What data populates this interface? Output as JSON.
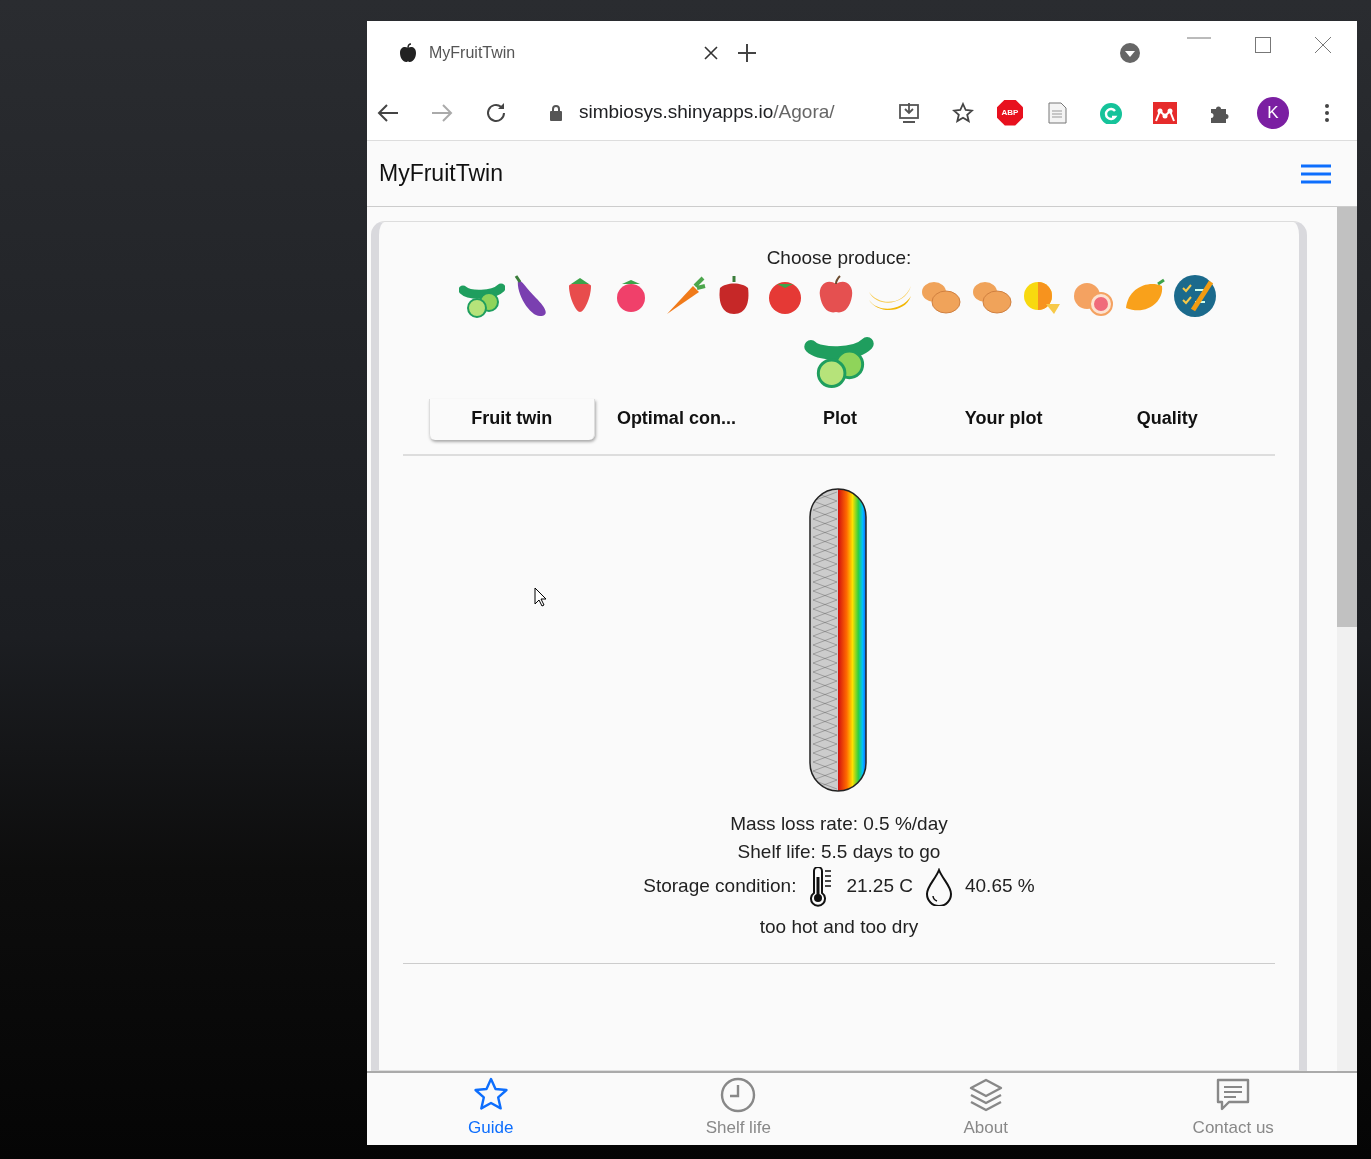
{
  "browser": {
    "tab": {
      "title": "MyFruitTwin"
    },
    "url_host": "simbiosys.shinyapps.io",
    "url_path": "/Agora/",
    "profile_initial": "K",
    "adblock_label": "ABP"
  },
  "app": {
    "brand": "MyFruitTwin",
    "choose_label": "Choose produce:",
    "produce": [
      {
        "kind": "cucumber"
      },
      {
        "kind": "eggplant"
      },
      {
        "kind": "strawberry"
      },
      {
        "kind": "raspberry"
      },
      {
        "kind": "carrot"
      },
      {
        "kind": "pepper"
      },
      {
        "kind": "tomato"
      },
      {
        "kind": "apple"
      },
      {
        "kind": "banana"
      },
      {
        "kind": "potato"
      },
      {
        "kind": "potato"
      },
      {
        "kind": "citrus"
      },
      {
        "kind": "grapefruit"
      },
      {
        "kind": "mango"
      },
      {
        "kind": "checklist"
      }
    ],
    "chosen_produce": {
      "kind": "cucumber"
    },
    "tabs": [
      {
        "label": "Fruit twin",
        "selected": true
      },
      {
        "label": "Optimal con...",
        "selected": false
      },
      {
        "label": "Plot",
        "selected": false
      },
      {
        "label": "Your plot",
        "selected": false
      },
      {
        "label": "Quality",
        "selected": false
      }
    ],
    "mass_loss": "Mass loss rate: 0.5 %/day",
    "shelf_life": "Shelf life: 5.5 days to go",
    "storage_label": "Storage condition:",
    "temperature": "21.25 C",
    "humidity": "40.65 %",
    "verdict": "too hot and too dry",
    "bottom_nav": [
      {
        "label": "Guide",
        "kind": "star",
        "selected": true
      },
      {
        "label": "Shelf life",
        "kind": "clock",
        "selected": false
      },
      {
        "label": "About",
        "kind": "layers",
        "selected": false
      },
      {
        "label": "Contact us",
        "kind": "chat",
        "selected": false
      }
    ]
  }
}
